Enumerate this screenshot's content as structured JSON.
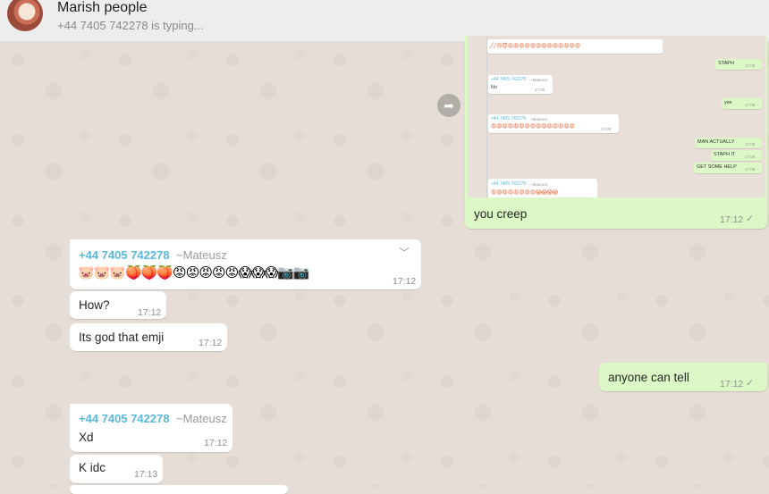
{
  "header": {
    "title": "Marish people",
    "status": "+44 7405 742278 is typing..."
  },
  "screenshot_thumb": {
    "rows": [
      {
        "text": "STAPH",
        "time": "17:08"
      },
      {
        "text": "yes",
        "time": "17:08"
      },
      {
        "phone": "+44 7405 742278",
        "name": "~Mateusz",
        "text": "No",
        "time": "17:08"
      },
      {
        "phone": "+44 7405 742278",
        "name": "~Mateusz",
        "time": "17:08"
      },
      {
        "text": "MAN ACTUALLY",
        "time": "17:08"
      },
      {
        "text": "STAPH IT",
        "time": "17:08"
      },
      {
        "text": "GET SOME HELP",
        "time": "17:08"
      },
      {
        "phone": "+44 7405 742278",
        "name": "~Mateusz"
      }
    ]
  },
  "messages": [
    {
      "text": "you creep",
      "time": "17:12"
    },
    {
      "phone": "+44 7405 742278",
      "name": "~Mateusz",
      "emojis": "🐷🐷🐷🍑🍑🍑😡😡😡😡😡😱😱😱📷📷",
      "time": "17:12"
    },
    {
      "text": "How?",
      "time": "17:12"
    },
    {
      "text": "Its god that emji",
      "time": "17:12"
    },
    {
      "text": "anyone can tell",
      "time": "17:12"
    },
    {
      "phone": "+44 7405 742278",
      "name": "~Mateusz",
      "text": "Xd",
      "time": "17:12"
    },
    {
      "text": "K idc",
      "time": "17:13"
    }
  ],
  "icons": {
    "forward": "forward-arrow-icon",
    "menu": "chevron-down-icon",
    "read": "double-check-icon"
  },
  "colors": {
    "outgoing": "#dcf8c6",
    "incoming": "#ffffff",
    "sender": "#58b9dc",
    "header": "#ededed"
  }
}
